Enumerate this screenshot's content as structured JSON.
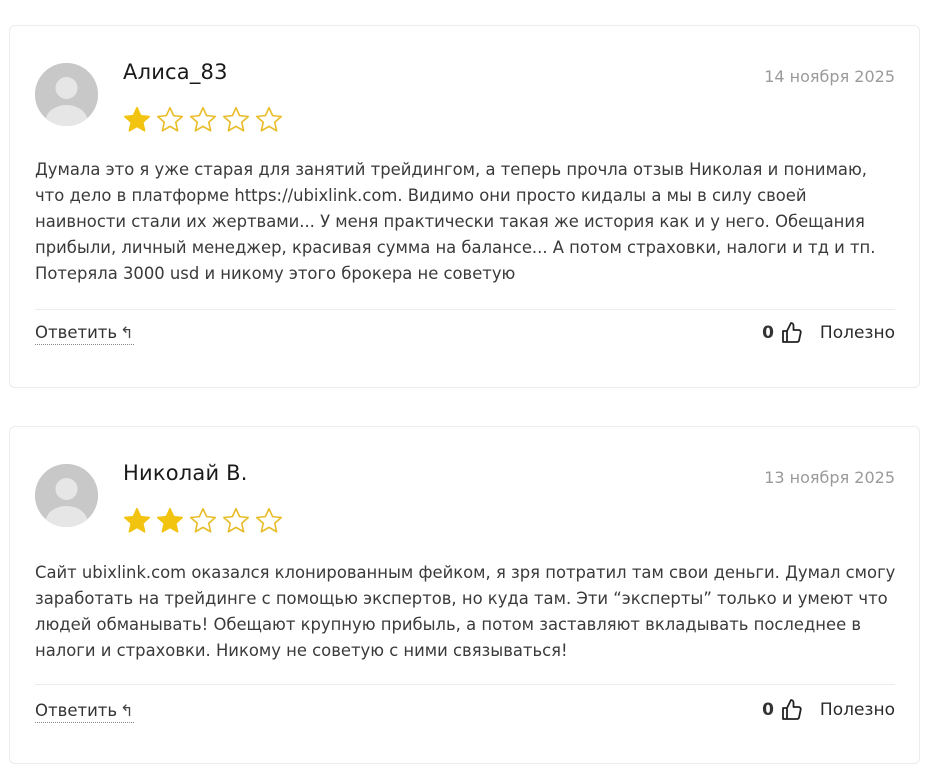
{
  "reviews": [
    {
      "author": "Алиса_83",
      "date": "14 ноября 2025",
      "rating": 1,
      "max_rating": 5,
      "text": "Думала это я уже старая для занятий трейдингом, а теперь прочла отзыв Николая и понимаю, что дело в платформе https://ubixlink.com. Видимо они просто кидалы а мы в силу своей наивности стали их жертвами... У меня практически такая же история как и у него. Обещания прибыли, личный менеджер, красивая сумма на балансе... А потом страховки, налоги и тд и тп. Потеряла 3000 usd и никому этого брокера не советую",
      "reply_label": "Ответить",
      "reply_icon": "↰",
      "helpful_count": "0",
      "helpful_label": "Полезно"
    },
    {
      "author": "Николай В.",
      "date": "13 ноября 2025",
      "rating": 2,
      "max_rating": 5,
      "text": "Сайт ubixlink.com оказался клонированным фейком, я зря потратил там свои деньги. Думал смогу заработать на трейдинге с помощью экспертов, но куда там. Эти “эксперты” только и умеют что людей обманывать! Обещают крупную прибыль, а потом заставляют вкладывать последнее в налоги и страховки. Никому не советую с ними связываться!",
      "reply_label": "Ответить",
      "reply_icon": "↰",
      "helpful_count": "0",
      "helpful_label": "Полезно"
    }
  ],
  "colors": {
    "star_filled": "#f2c40f",
    "star_outline": "#e9bd2a",
    "avatar_bg": "#c8c8c8",
    "date": "#9a9a9a"
  },
  "icons": {
    "avatar": "user-avatar-placeholder-icon",
    "star": "star-icon",
    "reply": "reply-arrow-icon",
    "thumb": "thumbs-up-icon"
  }
}
